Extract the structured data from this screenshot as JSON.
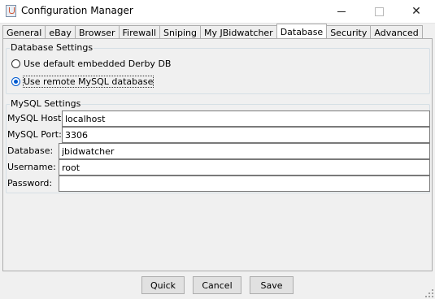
{
  "window": {
    "title": "Configuration Manager",
    "icon": "java-app-icon",
    "close_glyph": "✕"
  },
  "tabs": [
    {
      "label": "General",
      "selected": false
    },
    {
      "label": "eBay",
      "selected": false
    },
    {
      "label": "Browser",
      "selected": false
    },
    {
      "label": "Firewall",
      "selected": false
    },
    {
      "label": "Sniping",
      "selected": false
    },
    {
      "label": "My JBidwatcher",
      "selected": false
    },
    {
      "label": "Database",
      "selected": true
    },
    {
      "label": "Security",
      "selected": false
    },
    {
      "label": "Advanced",
      "selected": false
    }
  ],
  "database_settings": {
    "title": "Database Settings",
    "options": [
      {
        "label": "Use default embedded Derby DB",
        "checked": false
      },
      {
        "label": "Use remote MySQL database",
        "checked": true
      }
    ]
  },
  "mysql_settings": {
    "title": "MySQL Settings",
    "fields": [
      {
        "label": "MySQL Host:",
        "value": "localhost"
      },
      {
        "label": "MySQL Port:",
        "value": "3306"
      },
      {
        "label": "Database:",
        "value": "jbidwatcher"
      },
      {
        "label": "Username:",
        "value": "root"
      },
      {
        "label": "Password:",
        "value": ""
      }
    ]
  },
  "buttons": {
    "quick": "Quick",
    "cancel": "Cancel",
    "save": "Save"
  },
  "colors": {
    "selected_radio": "#005ad0",
    "window_background": "#f0f0f0"
  }
}
